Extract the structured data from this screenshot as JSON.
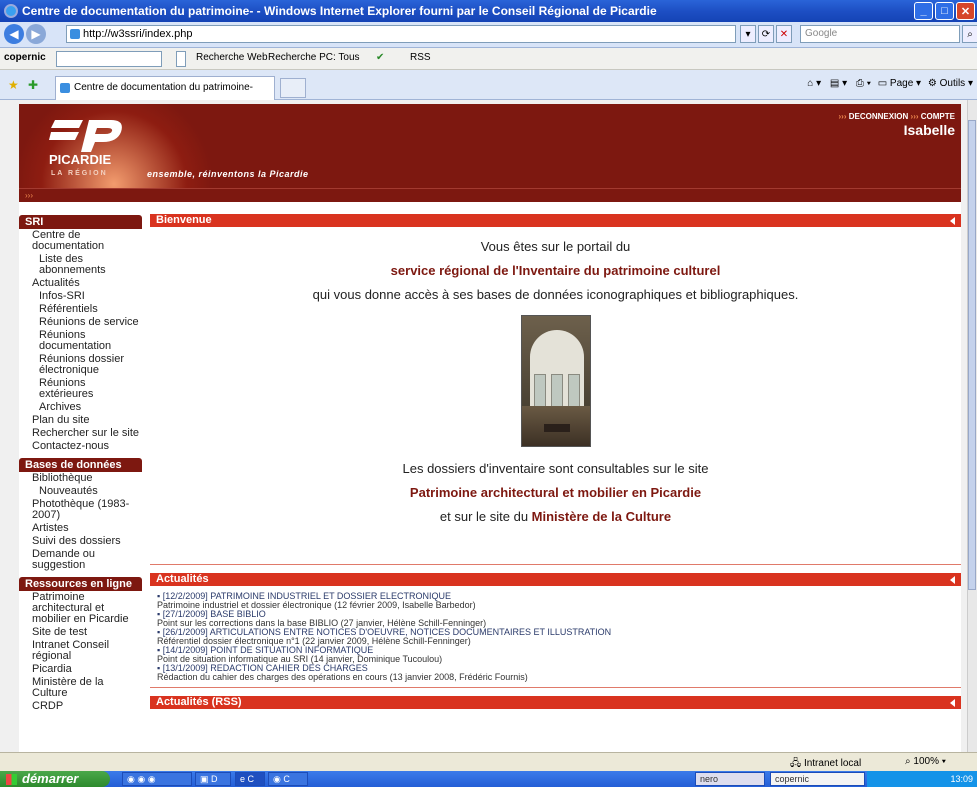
{
  "window": {
    "title": "Centre de documentation du patrimoine- - Windows Internet Explorer fourni par le Conseil Régional de Picardie"
  },
  "addressbar": {
    "url": "http://w3ssri/index.php",
    "search_placeholder": "Google"
  },
  "toolbar": {
    "brand": "copernic",
    "recherche_web": "Recherche Web",
    "recherche_pc": "Recherche PC: Tous",
    "rss": "RSS"
  },
  "tabs": {
    "active_label": "Centre de documentation du patrimoine-",
    "page_label": "Page",
    "outils_label": "Outils"
  },
  "banner": {
    "region_name": "PICARDIE",
    "region_sub": "LA RÉGION",
    "slogan": "ensemble, réinventons la Picardie",
    "link_deconnexion": "DECONNEXION",
    "link_compte": "COMPTE",
    "user": "Isabelle",
    "crumb": "›››"
  },
  "leftnav": {
    "sri_title": "SRI",
    "sri_items": [
      {
        "label": "Centre de documentation",
        "sub": false
      },
      {
        "label": "Liste des abonnements",
        "sub": true
      },
      {
        "label": "Actualités",
        "sub": false
      },
      {
        "label": "Infos-SRI",
        "sub": true
      },
      {
        "label": "Référentiels",
        "sub": true
      },
      {
        "label": "Réunions de service",
        "sub": true
      },
      {
        "label": "Réunions documentation",
        "sub": true
      },
      {
        "label": "Réunions dossier électronique",
        "sub": true
      },
      {
        "label": "Réunions extérieures",
        "sub": true
      },
      {
        "label": "Archives",
        "sub": true
      },
      {
        "label": "Plan du site",
        "sub": false
      },
      {
        "label": "Rechercher sur le site",
        "sub": false
      },
      {
        "label": "Contactez-nous",
        "sub": false
      }
    ],
    "bases_title": "Bases de données",
    "bases_items": [
      {
        "label": "Bibliothèque",
        "sub": false
      },
      {
        "label": "Nouveautés",
        "sub": true
      },
      {
        "label": "Photothèque (1983-2007)",
        "sub": false
      },
      {
        "label": "Artistes",
        "sub": false
      },
      {
        "label": "Suivi des dossiers",
        "sub": false
      },
      {
        "label": "Demande ou suggestion",
        "sub": false
      }
    ],
    "ressources_title": "Ressources en ligne",
    "ressources_items": [
      {
        "label": "Patrimoine architectural et mobilier en Picardie",
        "sub": false
      },
      {
        "label": "Site de test",
        "sub": false
      },
      {
        "label": "Intranet Conseil régional",
        "sub": false
      },
      {
        "label": "Picardia",
        "sub": false
      },
      {
        "label": "Ministère de la Culture",
        "sub": false
      },
      {
        "label": "CRDP",
        "sub": false
      }
    ]
  },
  "bienvenue": {
    "title": "Bienvenue",
    "line1": "Vous êtes sur le portail du",
    "line2": "service régional de l'Inventaire du patrimoine culturel",
    "line3": "qui vous donne accès à ses bases de données iconographiques et bibliographiques.",
    "line4": "Les dossiers d'inventaire sont consultables sur le site",
    "line5": "Patrimoine architectural et mobilier en Picardie",
    "line6_prefix": "et sur le site du",
    "line6_link": "Ministère de la Culture"
  },
  "actualites": {
    "title": "Actualités",
    "items": [
      {
        "headline": "[12/2/2009] PATRIMOINE INDUSTRIEL ET DOSSIER ELECTRONIQUE",
        "detail": "Patrimoine industriel et dossier électronique (12 février 2009, Isabelle Barbedor)"
      },
      {
        "headline": "[27/1/2009] BASE BIBLIO",
        "detail": "Point sur les corrections dans la base BIBLIO (27 janvier, Hélène Schill-Fenninger)"
      },
      {
        "headline": "[26/1/2009] ARTICULATIONS ENTRE NOTICES D'OEUVRE, NOTICES DOCUMENTAIRES ET ILLUSTRATION",
        "detail": "Référentiel dossier électronique n°1 (22 janvier 2009, Hélène Schill-Fenninger)"
      },
      {
        "headline": "[14/1/2009] POINT DE SITUATION INFORMATIQUE",
        "detail": "Point de situation informatique au SRI (14 janvier, Dominique Tucoulou)"
      },
      {
        "headline": "[13/1/2009] REDACTION CAHIER DES CHARGES",
        "detail": "Rédaction du cahier des charges des opérations en cours (13 janvier 2008, Frédéric Fournis)"
      }
    ]
  },
  "actualites_rss": {
    "title": "Actualités (RSS)"
  },
  "statusbar": {
    "zone": "Intranet local",
    "zoom": "100%"
  },
  "taskbar": {
    "start": "démarrer",
    "tray_time": "13:09",
    "item_copernic": "copernic"
  }
}
